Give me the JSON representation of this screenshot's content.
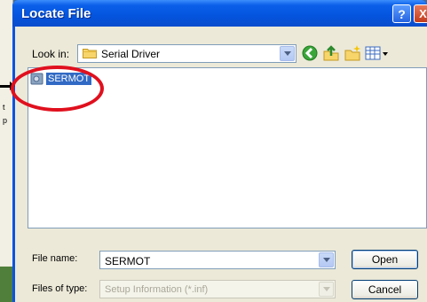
{
  "dialog": {
    "title": "Locate File",
    "help_glyph": "?",
    "close_glyph": "X"
  },
  "lookin": {
    "label": "Look in:",
    "value": "Serial Driver"
  },
  "files": [
    {
      "name": "SERMOT"
    }
  ],
  "filename": {
    "label": "File name:",
    "value": "SERMOT"
  },
  "filetype": {
    "label": "Files of type:",
    "value": "Setup Information (*.inf)"
  },
  "buttons": {
    "open_label": "Open",
    "cancel_label": "Cancel"
  },
  "background": {
    "text1": "t",
    "text2": "p"
  },
  "colors": {
    "titlebar": "#0454de",
    "selection": "#316ac5",
    "highlight_ring": "#e0101e"
  },
  "icons": {
    "lookin_folder": "folder-icon",
    "back": "back-arrow-icon",
    "up": "up-folder-icon",
    "new_folder": "new-folder-icon",
    "views": "view-menu-icon",
    "file": "setup-file-icon"
  }
}
